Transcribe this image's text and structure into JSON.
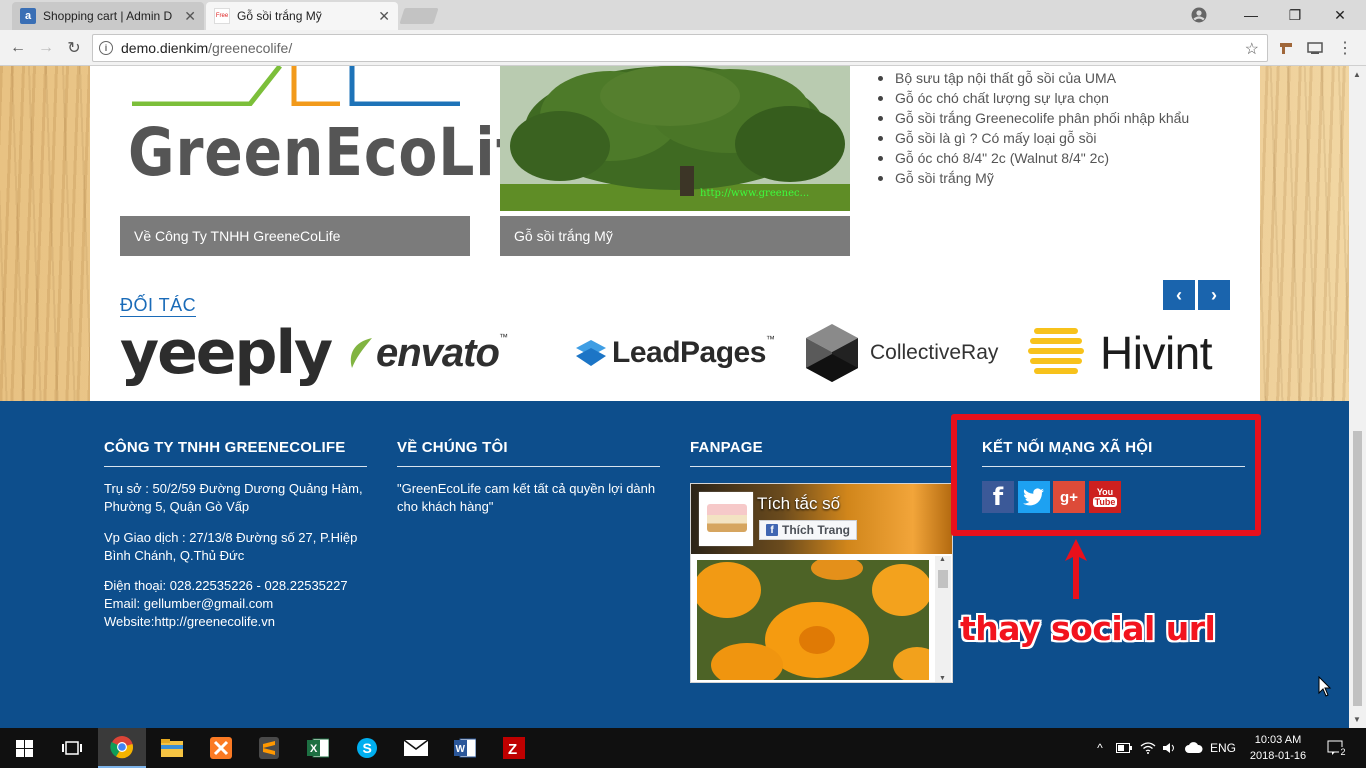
{
  "browser": {
    "tabs": [
      {
        "title": "Shopping cart | Admin D",
        "favicon": "a",
        "active": false
      },
      {
        "title": "Gỗ sồi trắng Mỹ",
        "favicon": "Free",
        "active": true
      }
    ],
    "url_host": "demo.dienkim",
    "url_path": "/greenecolife/"
  },
  "content": {
    "cards": [
      {
        "caption": "Về Công Ty TNHH GreeneCoLife",
        "logo_text": "GreenEcoLife"
      },
      {
        "caption": "Gỗ sồi trắng Mỹ",
        "watermark": "http://www.greenec..."
      }
    ],
    "recent_posts": [
      "Bộ sưu tập nội thất gỗ sồi của UMA",
      "Gỗ óc chó chất lượng sự lựa chọn",
      "Gỗ sồi trắng Greenecolife phân phối nhập khẩu",
      "Gỗ sồi là gì ? Có mấy loại gỗ sồi",
      "Gỗ óc chó 8/4\" 2c (Walnut 8/4\" 2c)",
      "Gỗ sồi trắng Mỹ"
    ],
    "partners_title": "ĐỐI TÁC",
    "partners": [
      "yeeply",
      "envato",
      "LeadPages",
      "CollectiveRay",
      "Hivint"
    ],
    "partner_marks": {
      "envato_tm": "™",
      "leadpages_tm": "™"
    },
    "prev_label": "‹",
    "next_label": "›"
  },
  "footer": {
    "company": {
      "title": "CÔNG TY TNHH GREENECOLIFE",
      "address": "Trụ sở : 50/2/59 Đường Dương Quảng Hàm, Phường 5, Quận Gò Vấp",
      "office": "Vp Giao dịch : 27/13/8 Đường số 27, P.Hiệp Bình Chánh, Q.Thủ Đức",
      "phone": "Điện thoại: 028.22535226 - 028.22535227",
      "email": "Email: gellumber@gmail.com",
      "website": "Website:http://greenecolife.vn"
    },
    "about": {
      "title": "VỀ CHÚNG TÔI",
      "text": "\"GreenEcoLife cam kết tất cả quyền lợi dành cho khách hàng\""
    },
    "fanpage": {
      "title": "FANPAGE",
      "page_name": "Tích tắc số",
      "like_label": "Thích Trang"
    },
    "social": {
      "title": "KẾT NỐI MẠNG XÃ HỘI",
      "icons": [
        "facebook-icon",
        "twitter-icon",
        "google-plus-icon",
        "youtube-icon"
      ],
      "labels": {
        "facebook": "f",
        "google_plus": "g+",
        "youtube_top": "You",
        "youtube_bottom": "Tube"
      }
    }
  },
  "annotation": {
    "text": "thay social url",
    "color": "#e8101c"
  },
  "taskbar": {
    "language": "ENG",
    "time": "10:03 AM",
    "date": "2018-01-16",
    "notification_count": "2"
  },
  "colors": {
    "footer_bg": "#0d4e8c",
    "accent_blue": "#1a64ad",
    "caption_gray": "#7b7b7b"
  }
}
